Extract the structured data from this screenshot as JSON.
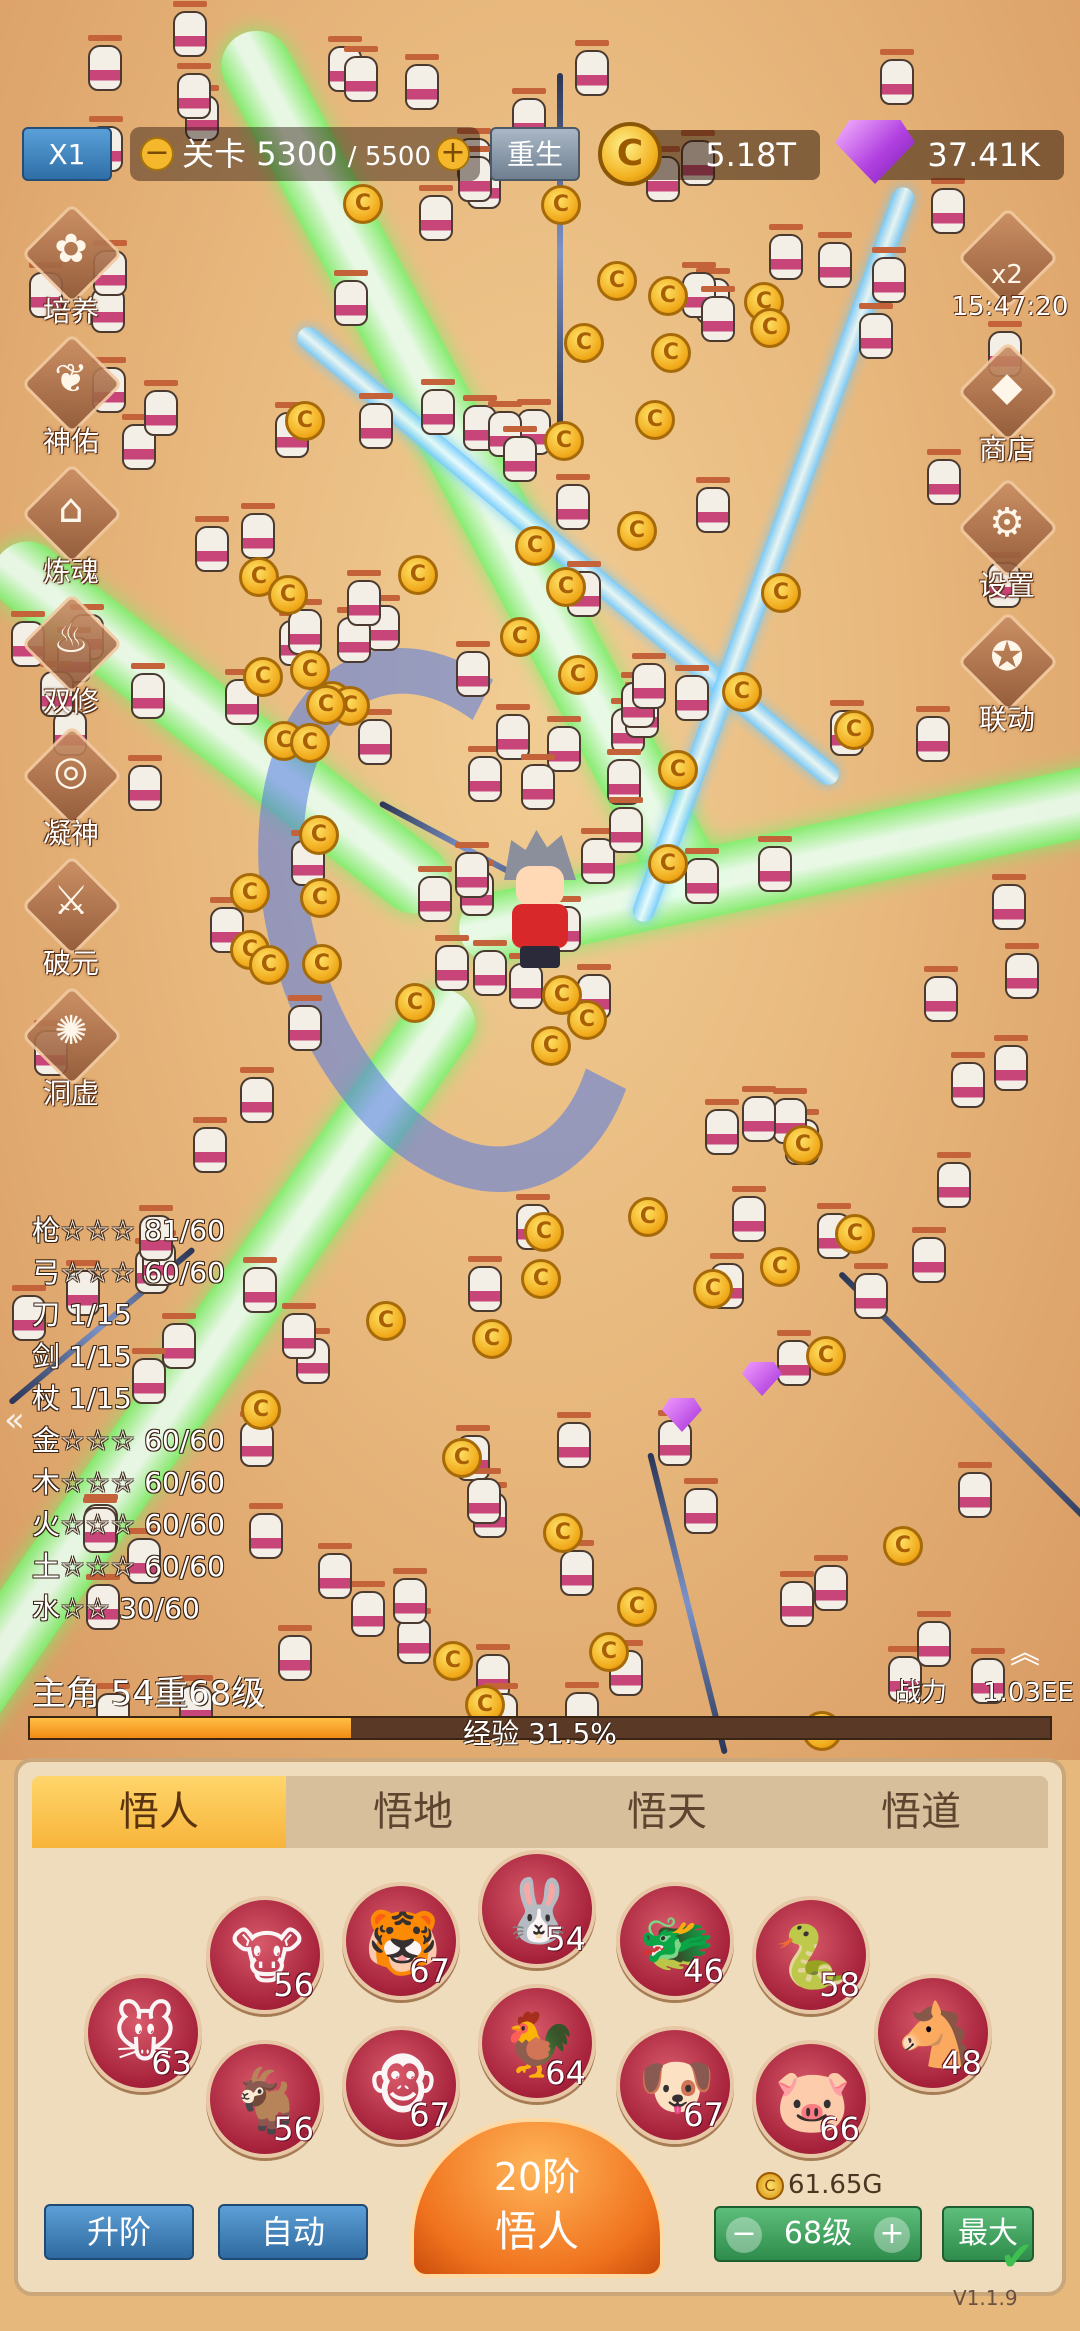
{
  "hud": {
    "speed": "X1",
    "level_label": "关卡",
    "level_current": "5300",
    "level_max": "/ 5500",
    "minus": "−",
    "plus": "+",
    "rebirth": "重生",
    "coin_symbol": "C",
    "gold": "5.18T",
    "gems": "37.41K"
  },
  "left_menu": [
    {
      "label": "培养",
      "icon": "clover-icon",
      "glyph": "✿"
    },
    {
      "label": "神佑",
      "icon": "wings-icon",
      "glyph": "❦"
    },
    {
      "label": "炼魂",
      "icon": "house-icon",
      "glyph": "⌂"
    },
    {
      "label": "双修",
      "icon": "flame-icon",
      "glyph": "♨"
    },
    {
      "label": "凝神",
      "icon": "spiral-icon",
      "glyph": "◎"
    },
    {
      "label": "破元",
      "icon": "sword-icon",
      "glyph": "⚔"
    },
    {
      "label": "洞虚",
      "icon": "fire-icon",
      "glyph": "✺"
    }
  ],
  "right_menu": {
    "boost": {
      "label": "x2",
      "timer": "15:47:20",
      "icon": "bag-icon"
    },
    "shop": {
      "label": "商店",
      "icon": "diamond-shop-icon",
      "glyph": "◆"
    },
    "settings": {
      "label": "设置",
      "icon": "gear-icon",
      "glyph": "⚙"
    },
    "link": {
      "label": "联动",
      "icon": "link-icon",
      "glyph": "✪"
    }
  },
  "weapons": [
    "枪☆☆☆ 81/60",
    "弓☆☆☆ 60/60",
    "刀 1/15",
    "剑 1/15",
    "杖 1/15",
    "金☆☆☆ 60/60",
    "木☆☆☆ 60/60",
    "火☆☆☆ 60/60",
    "土☆☆☆ 60/60",
    "水☆☆ 30/60"
  ],
  "collapse_arrow": "«",
  "protagonist": {
    "title": "主角 54重68级",
    "power_label": "战力",
    "power_value": "1.03EE",
    "exp_text": "经验 31.5%",
    "exp_fraction": 0.315
  },
  "up_chevron": "︽",
  "panel": {
    "tabs": [
      "悟人",
      "悟地",
      "悟天",
      "悟道"
    ],
    "active_tab": 0,
    "zodiac": [
      {
        "name": "rat",
        "glyph": "🐭",
        "level": "63"
      },
      {
        "name": "ox",
        "glyph": "🐮",
        "level": "56"
      },
      {
        "name": "tiger",
        "glyph": "🐯",
        "level": "67"
      },
      {
        "name": "rabbit",
        "glyph": "🐰",
        "level": "54"
      },
      {
        "name": "dragon",
        "glyph": "🐲",
        "level": "46"
      },
      {
        "name": "snake",
        "glyph": "🐍",
        "level": "58"
      },
      {
        "name": "horse",
        "glyph": "🐴",
        "level": "48"
      },
      {
        "name": "goat",
        "glyph": "🐐",
        "level": "56"
      },
      {
        "name": "monkey",
        "glyph": "🐵",
        "level": "67"
      },
      {
        "name": "rooster",
        "glyph": "🐓",
        "level": "64"
      },
      {
        "name": "dog",
        "glyph": "🐶",
        "level": "67"
      },
      {
        "name": "pig",
        "glyph": "🐷",
        "level": "66"
      }
    ],
    "upgrade_tier": "升阶",
    "auto": "自动",
    "tier_line1": "20阶",
    "tier_line2": "悟人",
    "cost": "61.65G",
    "minus": "−",
    "plus": "+",
    "level_select": "68级",
    "max": "最大",
    "version": "V1.1.9",
    "check": "✔"
  },
  "colors": {
    "accent": "#f7b43a",
    "zodiac_bg": "#a5213a",
    "beam": "#7cf06c"
  }
}
